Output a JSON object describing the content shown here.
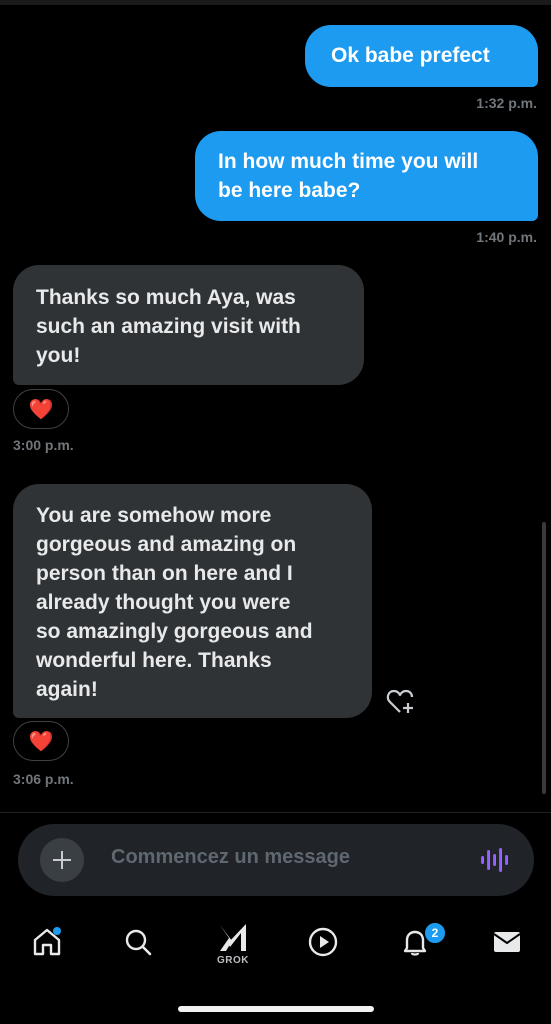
{
  "messages": [
    {
      "direction": "outgoing",
      "text": "Ok babe prefect",
      "time": "1:32 p.m."
    },
    {
      "direction": "outgoing",
      "text_lines": [
        "In how much time you will",
        "be here babe?"
      ],
      "time": "1:40 p.m."
    },
    {
      "direction": "incoming",
      "text_lines": [
        "Thanks so much Aya, was",
        "such an amazing visit with",
        "you!"
      ],
      "reaction": "❤️",
      "time": "3:00 p.m."
    },
    {
      "direction": "incoming",
      "text_lines": [
        "You are somehow more",
        "gorgeous and amazing on",
        "person than on here and I",
        "already thought you were",
        "so amazingly gorgeous and",
        "wonderful here. Thanks",
        "again!"
      ],
      "reaction": "❤️",
      "time": "3:06 p.m."
    }
  ],
  "composer": {
    "placeholder": "Commencez un message",
    "icons": [
      "plus-icon",
      "voice-waveform-icon"
    ]
  },
  "nav": {
    "items": [
      "home-icon",
      "search-icon",
      "grok-icon",
      "play-icon",
      "bell-icon",
      "mail-icon"
    ],
    "grok_label": "GROK",
    "notifications_badge": "2",
    "accent_color": "#1d9bf0"
  },
  "colors": {
    "outgoing_bubble": "#1d9bf0",
    "incoming_bubble": "#2f3336",
    "background": "#000000"
  }
}
